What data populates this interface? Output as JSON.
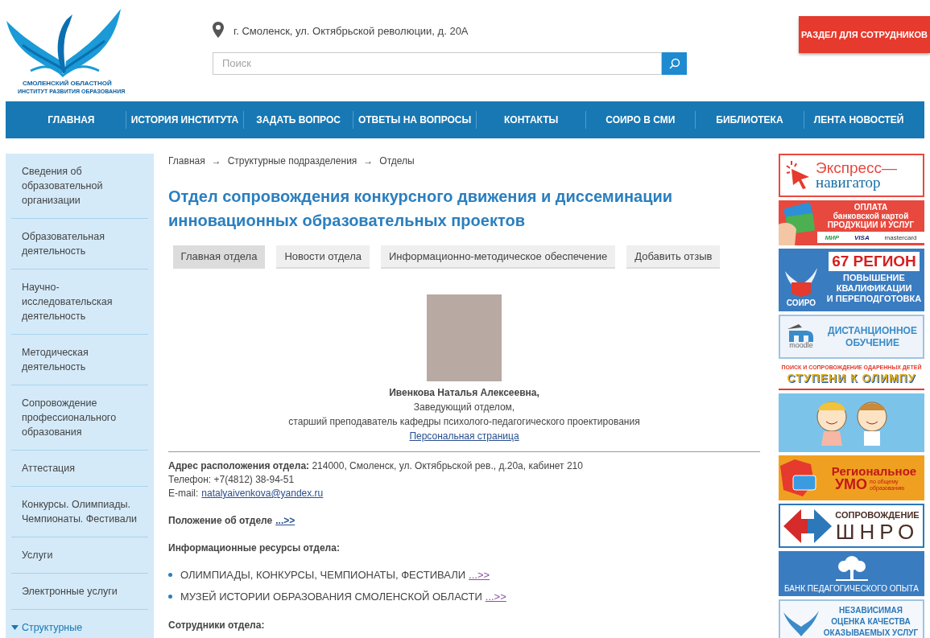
{
  "logo": {
    "line1": "СМОЛЕНСКИЙ ОБЛАСТНОЙ",
    "line2": "ИНСТИТУТ РАЗВИТИЯ ОБРАЗОВАНИЯ"
  },
  "address": "г. Смоленск, ул. Октябрьской революции, д. 20А",
  "search": {
    "placeholder": "Поиск"
  },
  "staff_button": "РАЗДЕЛ ДЛЯ СОТРУДНИКОВ",
  "nav": [
    "ГЛАВНАЯ",
    "ИСТОРИЯ ИНСТИТУТА",
    "ЗАДАТЬ ВОПРОС",
    "ОТВЕТЫ НА ВОПРОСЫ",
    "КОНТАКТЫ",
    "СОИРО В СМИ",
    "БИБЛИОТЕКА",
    "ЛЕНТА НОВОСТЕЙ"
  ],
  "sidebar": {
    "items": [
      {
        "label": "Сведения об образовательной организации",
        "expanded": false,
        "selected": false
      },
      {
        "label": "Образовательная деятельность",
        "expanded": false,
        "selected": false
      },
      {
        "label": "Научно-исследовательская деятельность",
        "expanded": false,
        "selected": false
      },
      {
        "label": "Методическая деятельность",
        "expanded": false,
        "selected": false
      },
      {
        "label": "Сопровождение профессионального образования",
        "expanded": false,
        "selected": false
      },
      {
        "label": "Аттестация",
        "expanded": false,
        "selected": false
      },
      {
        "label": "Конкурсы. Олимпиады. Чемпионаты. Фестивали",
        "expanded": false,
        "selected": false
      },
      {
        "label": "Услуги",
        "expanded": false,
        "selected": false
      },
      {
        "label": "Электронные услуги",
        "expanded": false,
        "selected": false
      },
      {
        "label": "Структурные",
        "expanded": true,
        "selected": true
      }
    ]
  },
  "breadcrumbs": [
    "Главная",
    "Структурные подразделения",
    "Отделы"
  ],
  "breadcrumb_separator": "→",
  "title": "Отдел сопровождения конкурсного движения и диссеминации инновационных образовательных проектов",
  "tabs": [
    {
      "label": "Главная отдела",
      "selected": true
    },
    {
      "label": "Новости отдела",
      "selected": false
    },
    {
      "label": "Информационно-методическое обеспечение",
      "selected": false
    },
    {
      "label": "Добавить отзыв",
      "selected": false
    }
  ],
  "head": {
    "name": "Ивенкова Наталья Алексеевна,",
    "position": "Заведующий отделом,",
    "title": "старший преподаватель кафедры психолого-педагогического проектирования",
    "link": "Персональная страница"
  },
  "contacts": {
    "address": "**Адрес расположения отдела:** 214000, Смоленск, ул. Октябрьской рев., д.20а, кабинет 210",
    "phone": "Телефон: +7(4812) 38-94-51",
    "email_label": "E-mail:",
    "email": "natalyaivenkova@yandex.ru"
  },
  "regulation": {
    "label": "Положение об отделе",
    "link": "...>>"
  },
  "resources": {
    "heading": "Информационные ресурсы отдела:",
    "items": [
      {
        "text": "ОЛИМПИАДЫ, КОНКУРСЫ, ЧЕМПИОНАТЫ, ФЕСТИВАЛИ",
        "link": "...>>"
      },
      {
        "text": "МУЗЕЙ ИСТОРИИ ОБРАЗОВАНИЯ СМОЛЕНСКОЙ ОБЛАСТИ",
        "link": "...>>"
      }
    ]
  },
  "staff_heading": "Сотрудники отдела:",
  "banners": [
    {
      "kind": "express",
      "lines": [
        "Экспресс—",
        "навигатор"
      ]
    },
    {
      "kind": "payment",
      "lines": [
        "ОПЛАТА",
        "банковской картой",
        "ПРОДУКЦИИ И УСЛУГ"
      ],
      "marks": [
        "МИР",
        "VISA",
        "mastercard"
      ]
    },
    {
      "kind": "region",
      "lines": [
        "67 РЕГИОН",
        "ПОВЫШЕНИЕ",
        "КВАЛИФИКАЦИИ",
        "И ПЕРЕПОДГОТОВКА"
      ],
      "caption": "СОИРО"
    },
    {
      "kind": "moodle",
      "lines": [
        "ДИСТАНЦИОННОЕ",
        "ОБУЧЕНИЕ"
      ],
      "caption": "moodle"
    },
    {
      "kind": "olymp",
      "lines": [
        "ПОИСК И СОПРОВОЖДЕНИЕ ОДАРЕННЫХ ДЕТЕЙ",
        "СТУПЕНИ К ОЛИМПУ"
      ]
    },
    {
      "kind": "kids"
    },
    {
      "kind": "umo",
      "lines": [
        "Региональное",
        "УМО",
        "по общему образованию"
      ]
    },
    {
      "kind": "shnro",
      "lines": [
        "СОПРОВОЖДЕНИЕ",
        "ШНРО"
      ]
    },
    {
      "kind": "bank",
      "lines": [
        "БАНК ПЕДАГОГИЧЕСКОГО ОПЫТА"
      ]
    },
    {
      "kind": "quality",
      "lines": [
        "НЕЗАВИСИМАЯ",
        "ОЦЕНКА КАЧЕСТВА",
        "ОКАЗЫВАЕМЫХ УСЛУГ"
      ]
    }
  ]
}
